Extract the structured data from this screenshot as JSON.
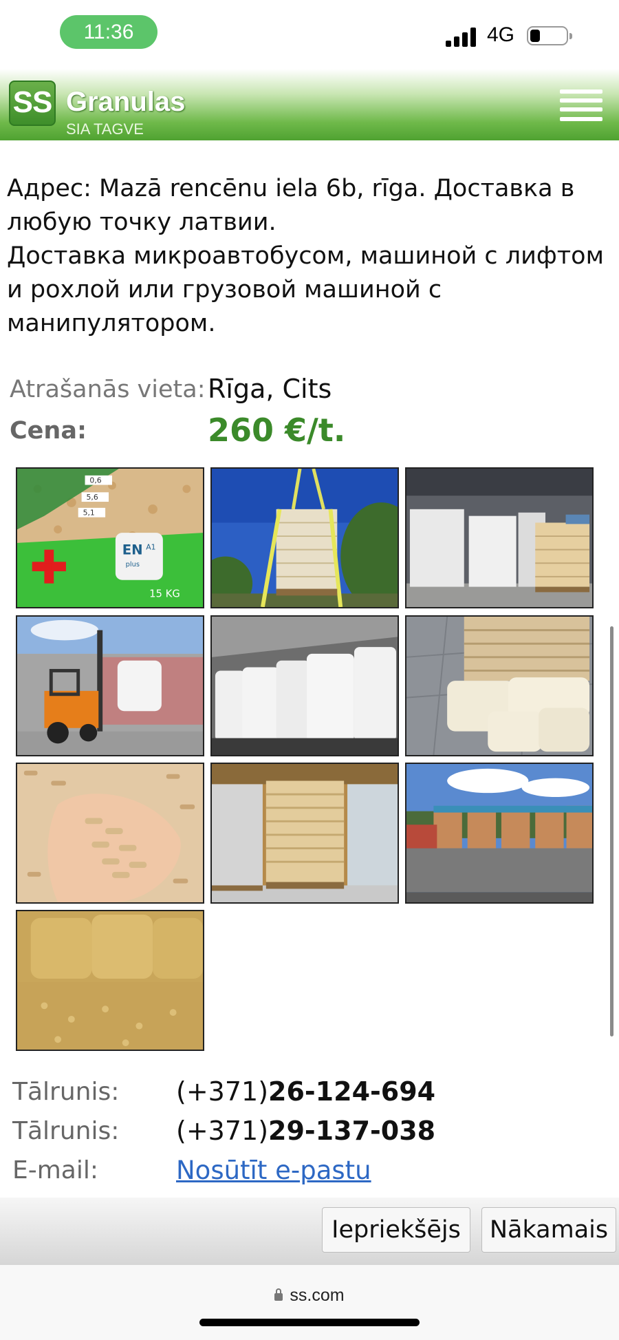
{
  "status_bar": {
    "time": "11:36",
    "network": "4G"
  },
  "header": {
    "logo_text": "SS",
    "title": "Granulas",
    "subtitle": "SIA TAGVE"
  },
  "description": {
    "line1": "Адрес: Mazā rencēnu iela 6b, rīga. Доставка в любую точку латвии.",
    "line2": "Доставка микроавтобусом, машиной с лифтом и рохлой или грузовой машиной с манипулятором."
  },
  "properties": {
    "location_label": "Atrašanās vieta:",
    "location_value": "Rīga, Cits",
    "price_label": "Cena:",
    "price_value": "260 €/t."
  },
  "gallery": [
    {
      "name": "pellet-bag-photo",
      "label_en": "EN",
      "label_plus": "plus",
      "label_a1": "A1",
      "label_weight": "15 KG",
      "label_06": "0,6",
      "label_56": "5,6",
      "label_51": "5,1"
    },
    {
      "name": "crane-bigbag-photo"
    },
    {
      "name": "warehouse-bigbags-photo"
    },
    {
      "name": "forklift-photo"
    },
    {
      "name": "truck-bigbags-photo"
    },
    {
      "name": "pallet-bags-photo"
    },
    {
      "name": "pellets-in-hand-photo"
    },
    {
      "name": "pallets-warehouse-photo"
    },
    {
      "name": "truck-pallets-photo"
    },
    {
      "name": "pellets-closeup-photo"
    }
  ],
  "contacts": {
    "phone_label": "Tālrunis:",
    "phone1_prefix": "(+371)",
    "phone1_number": "26-124-694",
    "phone2_prefix": "(+371)",
    "phone2_number": "29-137-038",
    "email_label": "E-mail:",
    "email_link": "Nosūtīt e-pastu"
  },
  "nav": {
    "prev": "Iepriekšējs",
    "next": "Nākamais"
  },
  "browser": {
    "url": "ss.com"
  },
  "colors": {
    "brand_green": "#4fa231",
    "price_green": "#3b8a2a",
    "link_blue": "#2d68c4"
  }
}
